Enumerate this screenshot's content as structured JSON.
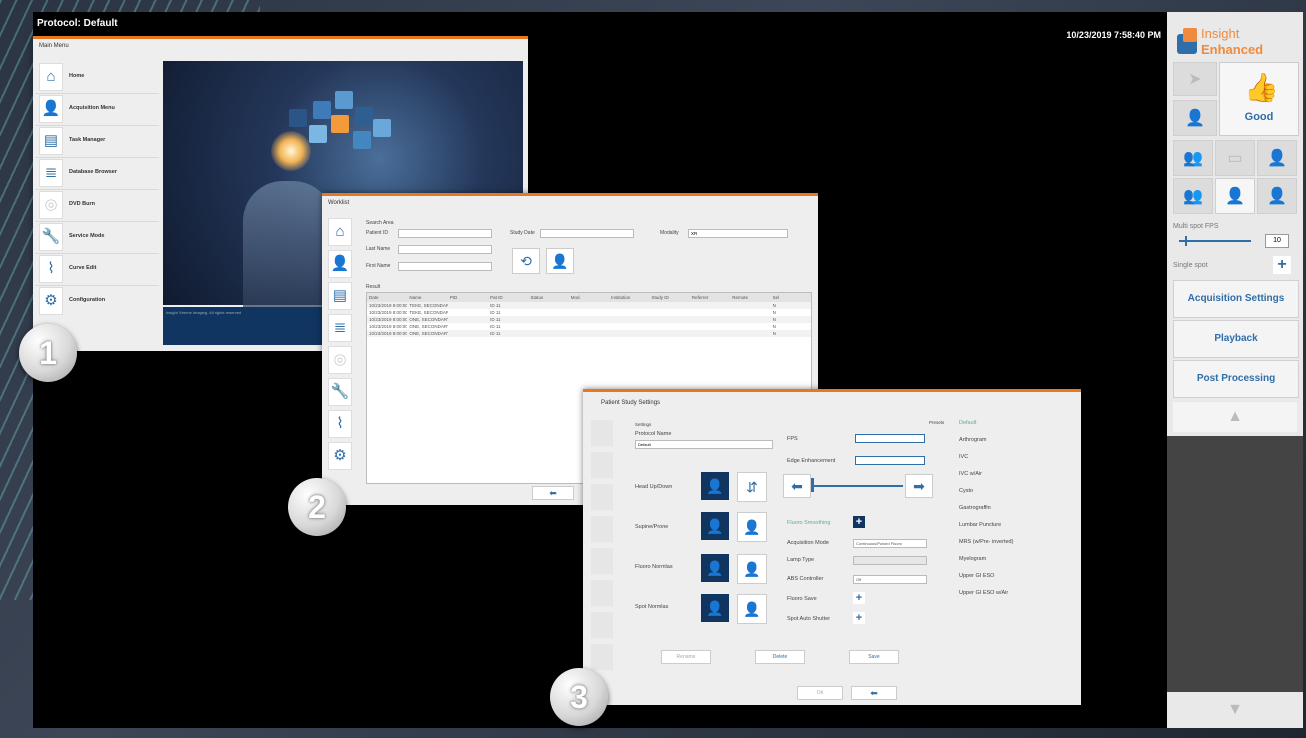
{
  "topbar": {
    "protocol": "Protocol: Default",
    "datetime": "10/23/2019 7:58:40 PM"
  },
  "brand": {
    "line1": "Insight",
    "line2": "Enhanced",
    "accent": "#f08a3c",
    "primary": "#2f6ea8"
  },
  "right_panel": {
    "good_label": "Good",
    "multi_spot_label": "Multi spot FPS",
    "fps_value": "10",
    "single_spot_label": "Single spot",
    "buttons": [
      "Acquisition Settings",
      "Playback",
      "Post Processing"
    ]
  },
  "main_menu": {
    "title": "Main Menu",
    "items": [
      "Home",
      "Acquisition Menu",
      "Task Manager",
      "Database Browser",
      "DVD Burn",
      "Service Mode",
      "Curve Edit",
      "Configuration"
    ],
    "footer": "Insight Xtreme Imaging. All rights reserved"
  },
  "worklist": {
    "title": "Worklist",
    "search_area": "Search Area",
    "patient_id_label": "Patient ID",
    "last_name_label": "Last Name",
    "first_name_label": "First Name",
    "study_date_label": "Study Date",
    "modality_label": "Modality",
    "modality_value": "XR",
    "result_label": "Result",
    "columns": [
      "Date",
      "Name",
      "PID",
      "Pat ID",
      "Status",
      "Mod.",
      "Institution",
      "Study ID",
      "Referrer",
      "Remote",
      "Sel"
    ],
    "rows": [
      [
        "10/23/2019 8:00:00 PM",
        "TEKE, SECONDARY 1...",
        "",
        "ID 11",
        "",
        "",
        "",
        "",
        "",
        "",
        "N"
      ],
      [
        "10/23/2019 8:00:00 PM",
        "TEKE, SECONDARY 1...",
        "",
        "ID 11",
        "",
        "",
        "",
        "",
        "",
        "",
        "N"
      ],
      [
        "10/23/2019 8:00:00 PM",
        "ONE, SECONDARY 1...",
        "",
        "ID 11",
        "",
        "",
        "",
        "",
        "",
        "",
        "N"
      ],
      [
        "10/23/2019 8:00:00 PM",
        "ONE, SECONDARY 1...",
        "",
        "ID 11",
        "",
        "",
        "",
        "",
        "",
        "",
        "N"
      ],
      [
        "10/23/2019 8:00:00 PM",
        "ONE, SECONDARY 1...",
        "",
        "ID 11",
        "",
        "",
        "",
        "",
        "",
        "",
        "N"
      ]
    ]
  },
  "pss": {
    "title": "Patient Study Settings",
    "settings": "Settings",
    "protocol_name_label": "Protocol Name",
    "protocol_name_value": "Default",
    "fps_label": "FPS",
    "edge_label": "Edge Enhancement",
    "row_labels": [
      "Head Up/Down",
      "Supine/Prone",
      "Fluoro Normlas",
      "Spot Normlas"
    ],
    "fluoro_smoothing": "Fluoro Smoothing",
    "acq_mode_label": "Acquisition Mode",
    "acq_mode_value": "Continuous/Pulsed Fluoro",
    "lamp_type_label": "Lamp Type",
    "abs_label": "ABS Controller",
    "abs_value": "Off",
    "fluoro_save_label": "Fluoro Save",
    "spot_auto_label": "Spot Auto Shutter",
    "presets_label": "Presets",
    "presets": [
      "Default",
      "Arthrogram",
      "IVC",
      "IVC w/Air",
      "Cysto",
      "Gastrograffin",
      "Lumbar Puncture",
      "MRS (w/Pre- inverted)",
      "Myelogram",
      "Upper GI ESO",
      "Upper GI ESO w/Air"
    ],
    "bottom_buttons": [
      "Rename",
      "Delete",
      "Save"
    ],
    "ok_label": "Ok"
  },
  "badges": [
    "1",
    "2",
    "3"
  ]
}
